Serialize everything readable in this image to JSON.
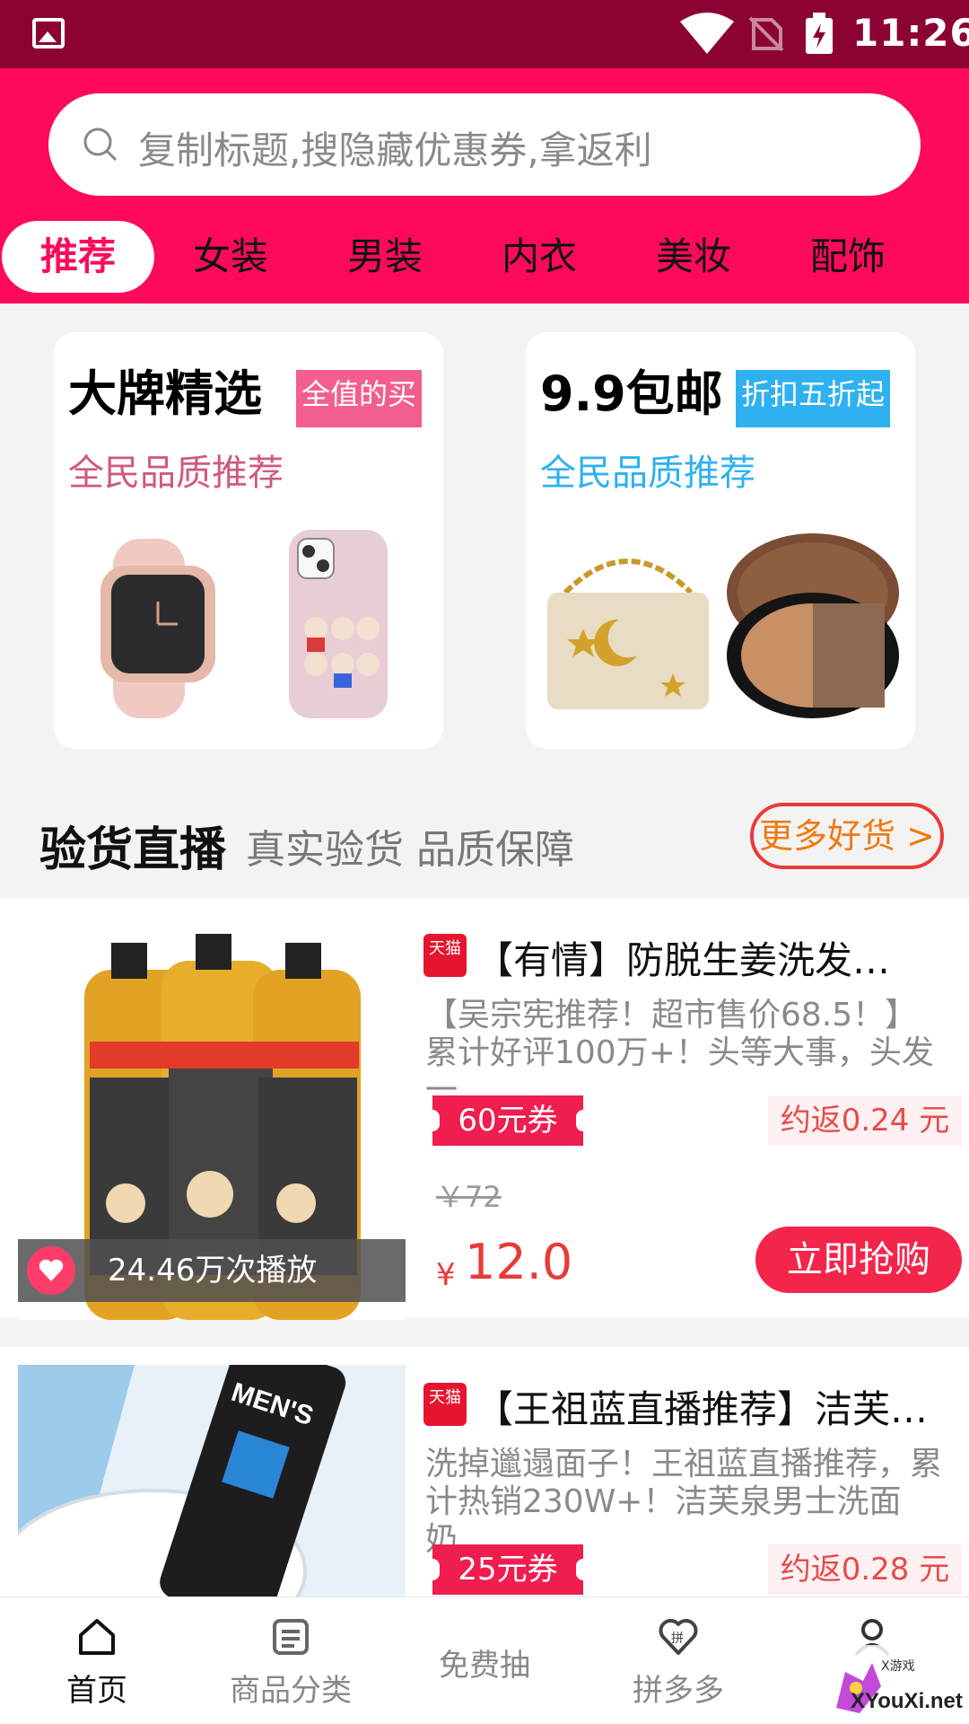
{
  "status_bar": {
    "time": "11:26"
  },
  "search": {
    "placeholder": "复制标题,搜隐藏优惠券,拿返利"
  },
  "tabs": [
    "推荐",
    "女装",
    "男装",
    "内衣",
    "美妆",
    "配饰"
  ],
  "promo_cards": [
    {
      "title": "大牌精选",
      "tag": "全值的买",
      "subtitle": "全民品质推荐",
      "accent": "#f25f8c",
      "subtitle_color": "#cf5a7d"
    },
    {
      "title": "9.9包邮",
      "tag": "折扣五折起",
      "subtitle": "全民品质推荐",
      "accent": "#2fb1f0",
      "subtitle_color": "#2fb1f0"
    }
  ],
  "live": {
    "title": "验货直播",
    "subtitle": "真实验货 品质保障",
    "more": "更多好货 >"
  },
  "products": [
    {
      "platform": "天猫",
      "title": "【有情】防脱生姜洗发…",
      "description": "【吴宗宪推荐！超市售价68.5！】累计好评100万+！头等大事，头发一…",
      "coupon": "60元券",
      "rebate": "约返0.24 元",
      "old_price": "￥72",
      "price_symbol": "¥",
      "price": "12.0",
      "buy": "立即抢购",
      "plays": "24.46万次播放"
    },
    {
      "platform": "天猫",
      "title": "【王祖蓝直播推荐】洁芙…",
      "description": "洗掉邋遢面子！王祖蓝直播推荐，累计热销230W+！洁芙泉男士洗面奶…",
      "coupon": "25元券",
      "rebate": "约返0.28 元"
    }
  ],
  "bottom_nav": [
    {
      "label": "首页",
      "icon": "home-icon"
    },
    {
      "label": "商品分类",
      "icon": "list-icon"
    },
    {
      "label": "免费抽",
      "icon": "none"
    },
    {
      "label": "拼多多",
      "icon": "heart-pin-icon"
    },
    {
      "label": "",
      "icon": "user-icon"
    }
  ],
  "colors": {
    "brand": "#fe0a5a",
    "statusbar": "#8c0234",
    "price": "#e93a3a"
  }
}
